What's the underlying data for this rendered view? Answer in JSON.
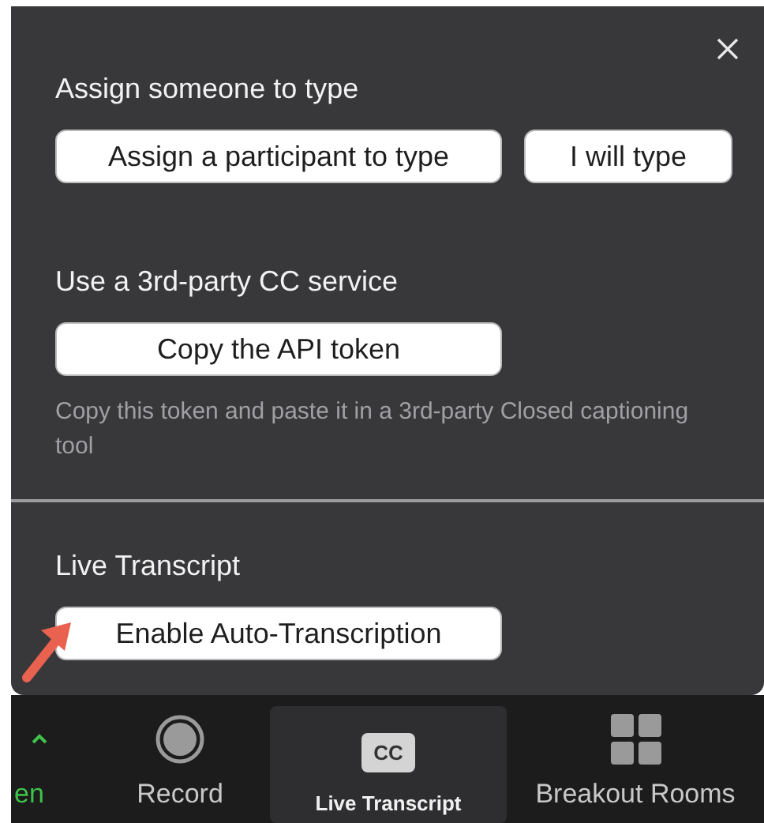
{
  "panel": {
    "sections": [
      {
        "title": "Assign someone to type",
        "buttons": [
          "Assign a participant to type",
          "I will type"
        ]
      },
      {
        "title": "Use a 3rd-party CC service",
        "buttons": [
          "Copy the API token"
        ],
        "hint": "Copy this token and paste it in a 3rd-party Closed captioning tool"
      },
      {
        "title": "Live Transcript",
        "buttons": [
          "Enable Auto-Transcription"
        ]
      }
    ]
  },
  "toolbar": {
    "items": [
      {
        "kind": "caret",
        "label": "en",
        "selected": false
      },
      {
        "kind": "record",
        "label": "Record",
        "selected": false
      },
      {
        "kind": "cc",
        "label": "Live Transcript",
        "icon_text": "CC",
        "selected": true
      },
      {
        "kind": "grid",
        "label": "Breakout Rooms",
        "selected": false
      }
    ]
  }
}
